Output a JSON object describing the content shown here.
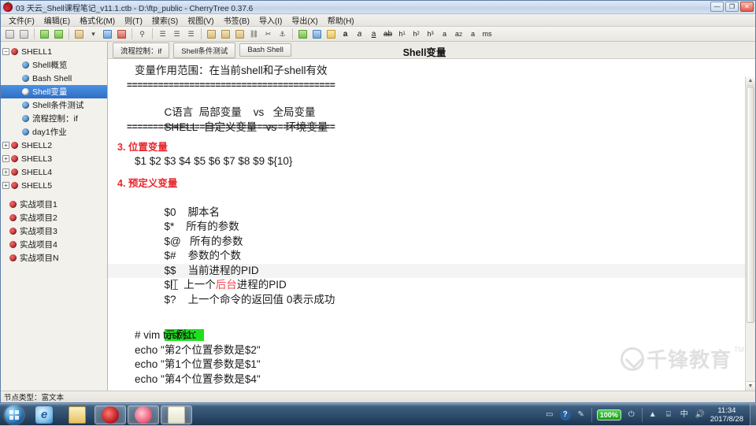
{
  "window": {
    "title": "03 天云_Shell课程笔记_v11.1.ctb - D:\\ftp_public - CherryTree 0.37.6",
    "app_icon": "cherry-icon",
    "buttons": {
      "minimize": "—",
      "maximize": "❐",
      "close": "✕"
    }
  },
  "menu": [
    {
      "label": "文件(F)"
    },
    {
      "label": "编辑(E)"
    },
    {
      "label": "格式化(M)"
    },
    {
      "label": "则(T)"
    },
    {
      "label": "搜索(S)"
    },
    {
      "label": "视图(V)"
    },
    {
      "label": "书签(B)"
    },
    {
      "label": "导入(I)"
    },
    {
      "label": "导出(X)"
    },
    {
      "label": "帮助(H)"
    }
  ],
  "toolbar": {
    "groups": [
      {
        "items": [
          {
            "name": "tree-node-up-icon",
            "glyph": "⬆"
          },
          {
            "name": "tree-node-down-icon",
            "glyph": "⬇"
          }
        ]
      },
      {
        "items": [
          {
            "name": "go-back-icon",
            "glyph": "◀"
          },
          {
            "name": "go-forward-icon",
            "glyph": "▶"
          }
        ]
      },
      {
        "items": [
          {
            "name": "new-node-icon",
            "glyph": "▤"
          },
          {
            "name": "new-node-dropdown-icon",
            "glyph": "▾"
          },
          {
            "name": "save-icon",
            "glyph": "▣"
          },
          {
            "name": "export-pdf-icon",
            "glyph": "⎙"
          }
        ]
      },
      {
        "items": [
          {
            "name": "find-icon",
            "glyph": "⚲"
          }
        ]
      },
      {
        "items": [
          {
            "name": "bulleted-list-icon",
            "glyph": "☰"
          },
          {
            "name": "numbered-list-icon",
            "glyph": "☰"
          },
          {
            "name": "todo-list-icon",
            "glyph": "☰"
          }
        ]
      },
      {
        "items": [
          {
            "name": "insert-image-icon",
            "glyph": "▥"
          },
          {
            "name": "insert-table-icon",
            "glyph": "▦"
          },
          {
            "name": "insert-codebox-icon",
            "glyph": "▧"
          },
          {
            "name": "insert-link-icon",
            "glyph": "⛓"
          }
        ]
      },
      {
        "items": [
          {
            "name": "link-icon",
            "glyph": "🔗"
          },
          {
            "name": "unlink-icon",
            "glyph": "✂"
          },
          {
            "name": "anchor-icon",
            "glyph": "⚓"
          }
        ]
      },
      {
        "items": [
          {
            "name": "background-color-icon",
            "glyph": "▨"
          },
          {
            "name": "foreground-color-icon",
            "glyph": "▩"
          },
          {
            "name": "highlight-color-icon",
            "glyph": "▪"
          }
        ]
      },
      {
        "items": [
          {
            "name": "bold-icon",
            "glyph": "a",
            "style": "bold"
          },
          {
            "name": "italic-icon",
            "glyph": "a",
            "style": "ital"
          },
          {
            "name": "underline-icon",
            "glyph": "a",
            "style": "under"
          },
          {
            "name": "strikethrough-icon",
            "glyph": "ab",
            "style": "strike"
          },
          {
            "name": "heading-1-icon",
            "glyph": "h1",
            "style": "hx"
          },
          {
            "name": "heading-2-icon",
            "glyph": "h2",
            "style": "hx"
          },
          {
            "name": "heading-3-icon",
            "glyph": "h3",
            "style": "hx"
          },
          {
            "name": "subscript-icon",
            "glyph": "a",
            "style": "hx"
          },
          {
            "name": "superscript-icon",
            "glyph": "a2",
            "style": "hx"
          },
          {
            "name": "small-text-icon",
            "glyph": "a",
            "style": "hx"
          },
          {
            "name": "monospace-icon",
            "glyph": "ms",
            "style": "hx"
          }
        ]
      }
    ]
  },
  "tree": {
    "nodes": [
      {
        "label": "SHELL1",
        "level": 0,
        "dot": "red",
        "expander": "−",
        "selected": false
      },
      {
        "label": "Shell概览",
        "level": 1,
        "dot": "blue",
        "expander": "",
        "selected": false
      },
      {
        "label": "Bash Shell",
        "level": 1,
        "dot": "blue",
        "expander": "",
        "selected": false
      },
      {
        "label": "Shell变量",
        "level": 1,
        "dot": "white",
        "expander": "",
        "selected": true
      },
      {
        "label": "Shell条件测试",
        "level": 1,
        "dot": "blue",
        "expander": "",
        "selected": false
      },
      {
        "label": "流程控制：if",
        "level": 1,
        "dot": "blue",
        "expander": "",
        "selected": false
      },
      {
        "label": "day1作业",
        "level": 1,
        "dot": "blue",
        "expander": "",
        "selected": false
      },
      {
        "label": "SHELL2",
        "level": 0,
        "dot": "red",
        "expander": "+",
        "selected": false
      },
      {
        "label": "SHELL3",
        "level": 0,
        "dot": "red",
        "expander": "+",
        "selected": false
      },
      {
        "label": "SHELL4",
        "level": 0,
        "dot": "red",
        "expander": "+",
        "selected": false
      },
      {
        "label": "SHELL5",
        "level": 0,
        "dot": "red",
        "expander": "+",
        "selected": false
      },
      {
        "label": "实战项目1",
        "level": 0,
        "dot": "red",
        "expander": "",
        "selected": false
      },
      {
        "label": "实战项目2",
        "level": 0,
        "dot": "red",
        "expander": "",
        "selected": false
      },
      {
        "label": "实战项目3",
        "level": 0,
        "dot": "red",
        "expander": "",
        "selected": false
      },
      {
        "label": "实战项目4",
        "level": 0,
        "dot": "red",
        "expander": "",
        "selected": false
      },
      {
        "label": "实战项目N",
        "level": 0,
        "dot": "red",
        "expander": "",
        "selected": false
      }
    ]
  },
  "tabs": [
    {
      "label": "流程控制：if"
    },
    {
      "label": "Shell条件测试"
    },
    {
      "label": "Bash Shell"
    }
  ],
  "document": {
    "header": "Shell变量",
    "scope_line": "变量作用范围：在当前shell和子shell有效",
    "sep_top": "========================================",
    "sep_bottom": "========================================",
    "compare": [
      {
        "lang": "C语言",
        "local": "局部变量",
        "vs": "vs",
        "global": "全局变量"
      },
      {
        "lang": "SHELL",
        "local": "自定义变量",
        "vs": "vs",
        "global": "环境变量"
      }
    ],
    "section3_title": "3. 位置变量",
    "section3_body": "$1 $2 $3 $4 $5 $6 $7 $8 $9 ${10}",
    "section4_title": "4. 预定义变量",
    "predefined": [
      {
        "var": "$0",
        "desc": "脚本名"
      },
      {
        "var": "$*",
        "desc": "所有的参数"
      },
      {
        "var": "$@",
        "desc": "所有的参数"
      },
      {
        "var": "$#",
        "desc": "参数的个数"
      },
      {
        "var": "$$",
        "desc": "当前进程的PID"
      }
    ],
    "cursor_line": {
      "var": "$!",
      "pre": "上一个",
      "hl": "后台",
      "post": "进程的PID"
    },
    "last_line": {
      "var": "$?",
      "desc": "上一个命令的返回值 0表示成功"
    },
    "example_label": "示例1：",
    "example_lines": [
      "# vim test.sh",
      "echo \"第2个位置参数是$2\"",
      "echo \"第1个位置参数是$1\"",
      "echo \"第4个位置参数是$4\""
    ],
    "watermark": {
      "text": "千锋教育",
      "tm": "TM"
    }
  },
  "status_bar": {
    "text": "节点类型：富文本"
  },
  "taskbar": {
    "start": "start-orb",
    "items": [
      {
        "name": "taskbar-item-internet-explorer",
        "icon": "ie"
      },
      {
        "name": "taskbar-item-file-explorer",
        "icon": "folder"
      },
      {
        "name": "taskbar-item-cherrytree",
        "icon": "cherry",
        "active": true
      },
      {
        "name": "taskbar-item-media",
        "icon": "pink",
        "active": true
      },
      {
        "name": "taskbar-item-paint",
        "icon": "paint",
        "active": true
      }
    ],
    "tray": {
      "help_icon": "?",
      "pen_icon": "✎",
      "battery": "100%",
      "plug_icon": "🔌",
      "chevron": "▲",
      "network_icon": "⌸",
      "ime_icon": "中",
      "volume_icon": "🔊",
      "time": "11:34",
      "date": "2017/8/28"
    }
  },
  "colors": {
    "selection": "#2f6fc4",
    "section_red": "#e8272c",
    "highlight_green": "#1fe01f",
    "inline_red": "#ee4b52"
  }
}
